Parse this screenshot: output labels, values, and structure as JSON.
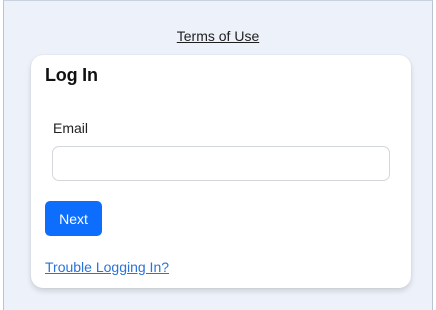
{
  "header": {
    "terms_link": "Terms of Use"
  },
  "login_card": {
    "title": "Log In",
    "email_label": "Email",
    "email_value": "",
    "email_placeholder": "",
    "next_button": "Next",
    "trouble_link": "Trouble Logging In?"
  },
  "colors": {
    "background": "#edf1f9",
    "card": "#ffffff",
    "primary_button": "#0d6efd",
    "link": "#2a73d9"
  }
}
